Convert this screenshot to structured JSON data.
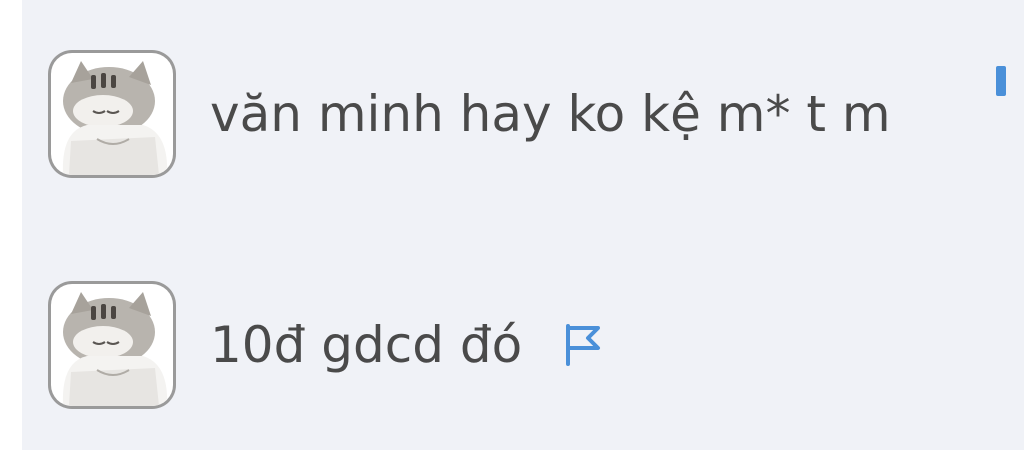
{
  "comments": [
    {
      "text": "văn minh hay ko kệ m* t m",
      "avatar_icon": "cat-avatar-icon",
      "flag_icon": "flag-icon"
    },
    {
      "text": "10đ gdcd đó",
      "avatar_icon": "cat-avatar-icon",
      "flag_icon": "flag-icon"
    }
  ],
  "colors": {
    "background": "#f0f2f7",
    "text": "#4a4a4a",
    "accent": "#4a90d9"
  }
}
